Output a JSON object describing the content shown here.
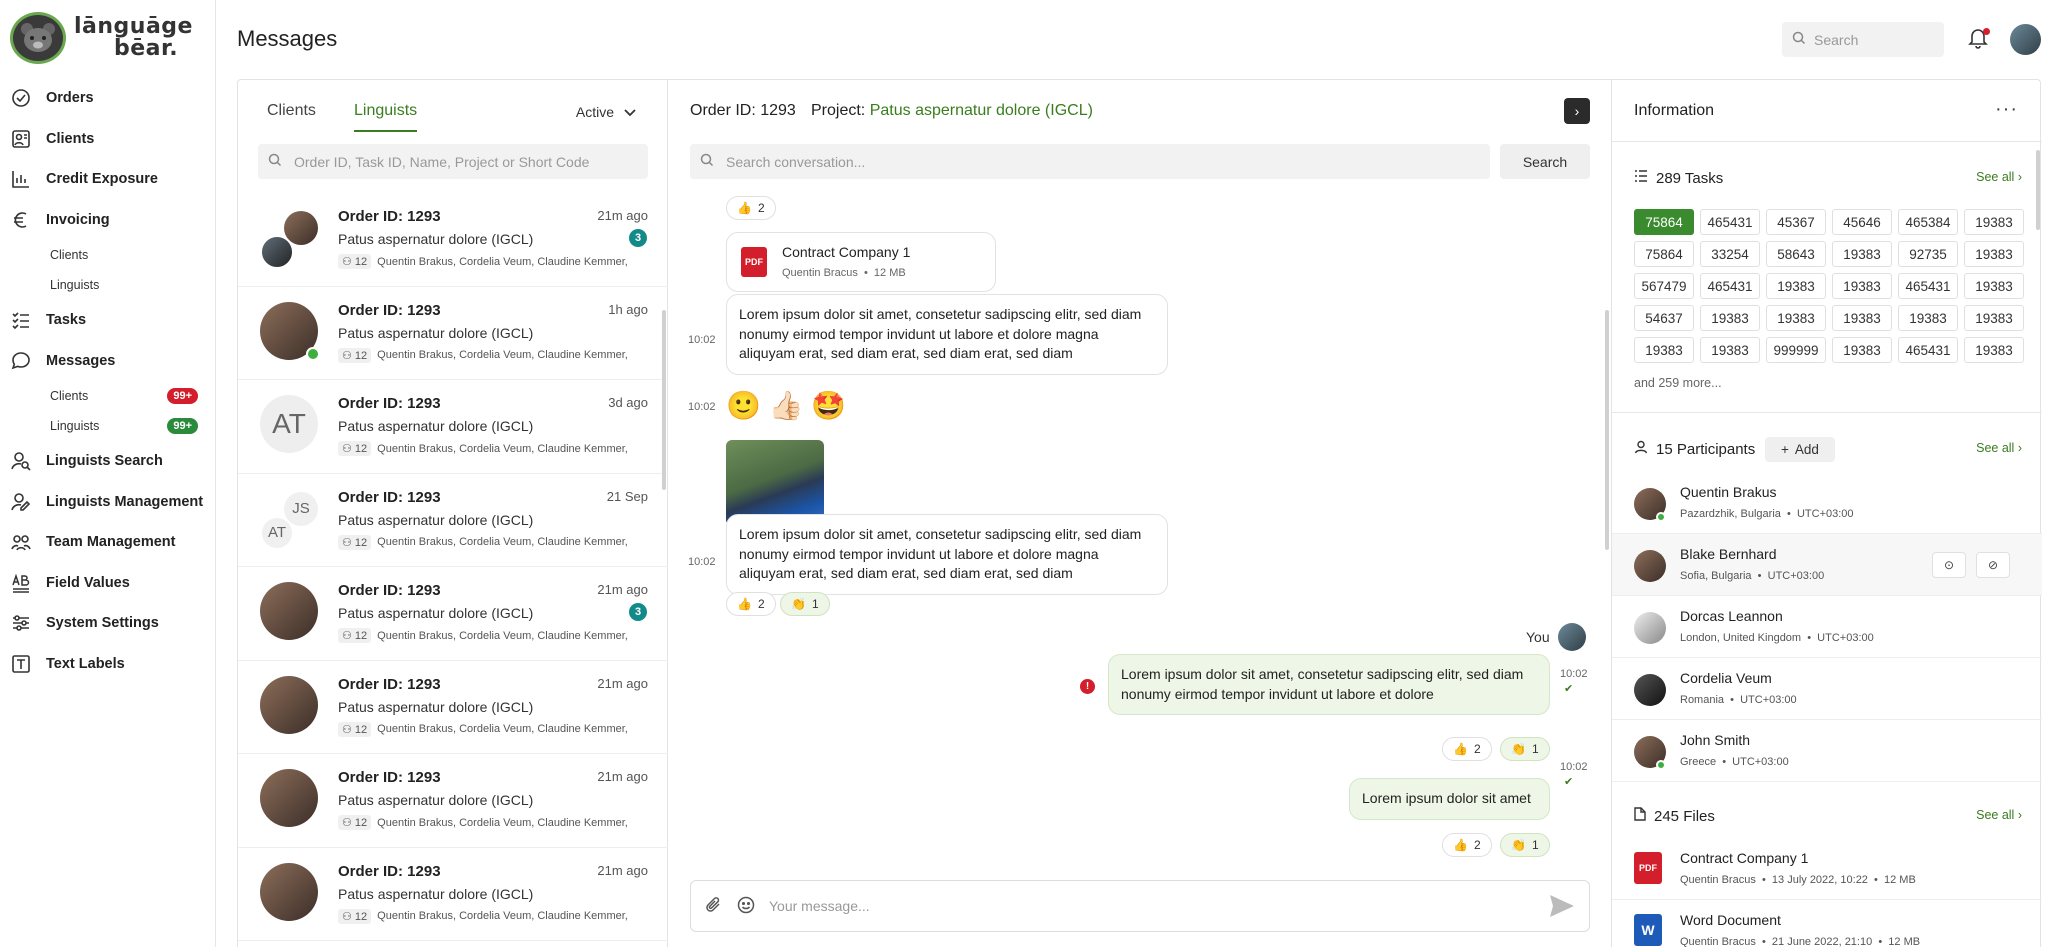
{
  "app": {
    "logo_text_line1": "lānguāge",
    "logo_text_line2": "bēar."
  },
  "sidebar": {
    "items": [
      {
        "label": "Orders",
        "icon": "orders-icon"
      },
      {
        "label": "Clients",
        "icon": "clients-icon"
      },
      {
        "label": "Credit Exposure",
        "icon": "chart-icon"
      },
      {
        "label": "Invoicing",
        "icon": "euro-icon"
      },
      {
        "label": "Tasks",
        "icon": "tasks-icon"
      },
      {
        "label": "Messages",
        "icon": "chat-icon"
      },
      {
        "label": "Linguists Search",
        "icon": "user-search-icon"
      },
      {
        "label": "Linguists Management",
        "icon": "user-manage-icon"
      },
      {
        "label": "Team Management",
        "icon": "team-icon"
      },
      {
        "label": "Field Values",
        "icon": "field-values-icon"
      },
      {
        "label": "System Settings",
        "icon": "settings-sliders-icon"
      },
      {
        "label": "Text Labels",
        "icon": "text-labels-icon"
      }
    ],
    "invoicing_sub": [
      "Clients",
      "Linguists"
    ],
    "messages_sub": [
      {
        "label": "Clients",
        "badge": "99+"
      },
      {
        "label": "Linguists",
        "badge": "99+"
      }
    ]
  },
  "header": {
    "title": "Messages",
    "search_placeholder": "Search"
  },
  "left": {
    "tabs": [
      "Clients",
      "Linguists"
    ],
    "active_tab": "Linguists",
    "status": "Active",
    "search_placeholder": "Order ID, Task ID, Name, Project or Short Code",
    "conversations": [
      {
        "order": "Order ID: 1293",
        "title": "Patus aspernatur dolore (IGCL)",
        "count": "12",
        "people": "Quentin Brakus, Cordelia Veum, Claudine Kemmer, John Smith",
        "time": "21m ago",
        "unread": "3"
      },
      {
        "order": "Order ID: 1293",
        "title": "Patus aspernatur dolore (IGCL)",
        "count": "12",
        "people": "Quentin Brakus, Cordelia Veum, Claudine Kemmer, John Smith",
        "time": "1h ago",
        "unread": ""
      },
      {
        "order": "Order ID: 1293",
        "title": "Patus aspernatur dolore (IGCL)",
        "count": "12",
        "people": "Quentin Brakus, Cordelia Veum, Claudine Kemmer, John Smith",
        "time": "3d ago",
        "unread": "",
        "initials": "AT"
      },
      {
        "order": "Order ID: 1293",
        "title": "Patus aspernatur dolore (IGCL)",
        "count": "12",
        "people": "Quentin Brakus, Cordelia Veum, Claudine Kemmer, John Smith",
        "time": "21 Sep",
        "unread": "",
        "initials_a": "JS",
        "initials_b": "AT"
      },
      {
        "order": "Order ID: 1293",
        "title": "Patus aspernatur dolore (IGCL)",
        "count": "12",
        "people": "Quentin Brakus, Cordelia Veum, Claudine Kemmer, John Smith",
        "time": "21m ago",
        "unread": "3"
      },
      {
        "order": "Order ID: 1293",
        "title": "Patus aspernatur dolore (IGCL)",
        "count": "12",
        "people": "Quentin Brakus, Cordelia Veum, Claudine Kemmer, John Smith",
        "time": "21m ago",
        "unread": ""
      },
      {
        "order": "Order ID: 1293",
        "title": "Patus aspernatur dolore (IGCL)",
        "count": "12",
        "people": "Quentin Brakus, Cordelia Veum, Claudine Kemmer, John Smith",
        "time": "21m ago",
        "unread": ""
      },
      {
        "order": "Order ID: 1293",
        "title": "Patus aspernatur dolore (IGCL)",
        "count": "12",
        "people": "Quentin Brakus, Cordelia Veum, Claudine Kemmer, John Smith",
        "time": "21m ago",
        "unread": ""
      }
    ]
  },
  "chat": {
    "order": "Order ID: 1293",
    "project_label": "Project:",
    "project_name": "Patus aspernatur dolore (IGCL)",
    "search_placeholder": "Search conversation...",
    "search_button": "Search",
    "react_thumb_count": "2",
    "react_clap_count": "1",
    "file_name": "Contract Company 1",
    "file_author": "Quentin Bracus",
    "file_size": "12 MB",
    "msg_long": "Lorem ipsum dolor sit amet, consetetur sadipscing elitr, sed diam nonumy eirmod tempor invidunt ut labore et dolore magna aliquyam erat, sed diam erat, sed diam erat, sed diam",
    "msg_out1": "Lorem ipsum dolor sit amet, consetetur sadipscing elitr, sed diam nonumy eirmod tempor invidunt ut labore et dolore",
    "msg_out2": "Lorem ipsum dolor sit amet",
    "time": "10:02",
    "you_label": "You",
    "emojis": "🙂 👍🏻 🤩",
    "composer_placeholder": "Your message..."
  },
  "info": {
    "title": "Information",
    "tasks_title": "289 Tasks",
    "see_all": "See all",
    "tasks": [
      "75864",
      "465431",
      "45367",
      "45646",
      "465384",
      "19383",
      "75864",
      "33254",
      "58643",
      "19383",
      "92735",
      "19383",
      "567479",
      "465431",
      "19383",
      "19383",
      "465431",
      "19383",
      "54637",
      "19383",
      "19383",
      "19383",
      "19383",
      "19383",
      "19383",
      "19383",
      "999999",
      "19383",
      "465431",
      "19383"
    ],
    "more": "and 259 more...",
    "participants_title": "15 Participants",
    "add_label": "Add",
    "participants": [
      {
        "name": "Quentin Brakus",
        "loc": "Pazardzhik, Bulgaria",
        "tz": "UTC+03:00"
      },
      {
        "name": "Blake Bernhard",
        "loc": "Sofia, Bulgaria",
        "tz": "UTC+03:00"
      },
      {
        "name": "Dorcas Leannon",
        "loc": "London, United Kingdom",
        "tz": "UTC+03:00"
      },
      {
        "name": "Cordelia Veum",
        "loc": "Romania",
        "tz": "UTC+03:00"
      },
      {
        "name": "John Smith",
        "loc": "Greece",
        "tz": "UTC+03:00"
      }
    ],
    "files_title": "245 Files",
    "files": [
      {
        "name": "Contract Company 1",
        "author": "Quentin Bracus",
        "date": "13 July 2022, 10:22",
        "size": "12 MB"
      },
      {
        "name": "Word Document",
        "author": "Quentin Bracus",
        "date": "21 June 2022, 21:10",
        "size": "12 MB"
      }
    ]
  },
  "colors": {
    "accent": "#3a7d1e",
    "badge_red": "#d21f2b",
    "badge_green": "#2a8b3d",
    "unread_teal": "#138a8a"
  }
}
